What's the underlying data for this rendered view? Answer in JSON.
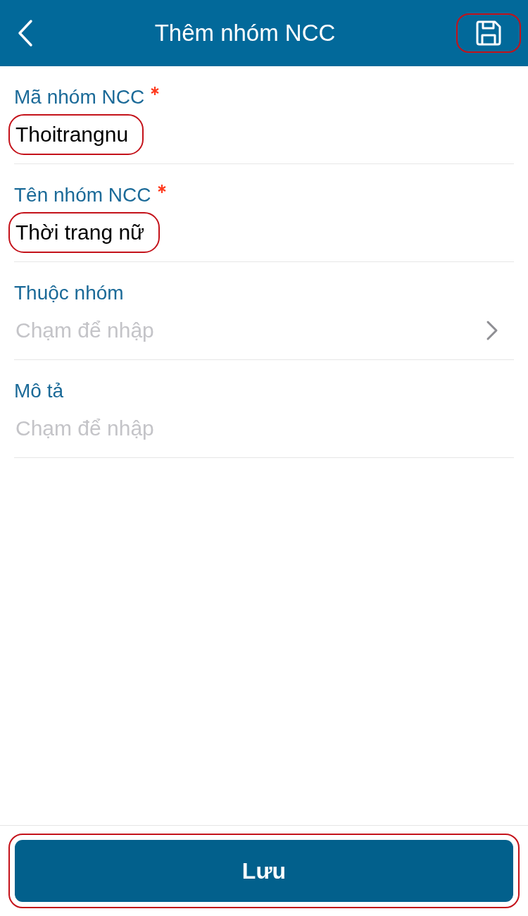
{
  "header": {
    "title": "Thêm nhóm NCC",
    "save_highlighted": true
  },
  "fields": [
    {
      "kind": "text",
      "label": "Mã nhóm NCC",
      "required": true,
      "value": "Thoitrangnu",
      "highlighted": true
    },
    {
      "kind": "text",
      "label": "Tên nhóm NCC",
      "required": true,
      "value": "Thời trang nữ",
      "highlighted": true
    },
    {
      "kind": "select",
      "label": "Thuộc nhóm",
      "required": false,
      "placeholder": "Chạm để nhập",
      "highlighted": false
    },
    {
      "kind": "text",
      "label": "Mô tả",
      "required": false,
      "placeholder": "Chạm để nhập",
      "highlighted": false
    }
  ],
  "save_button": {
    "label": "Lưu",
    "highlighted": true
  }
}
